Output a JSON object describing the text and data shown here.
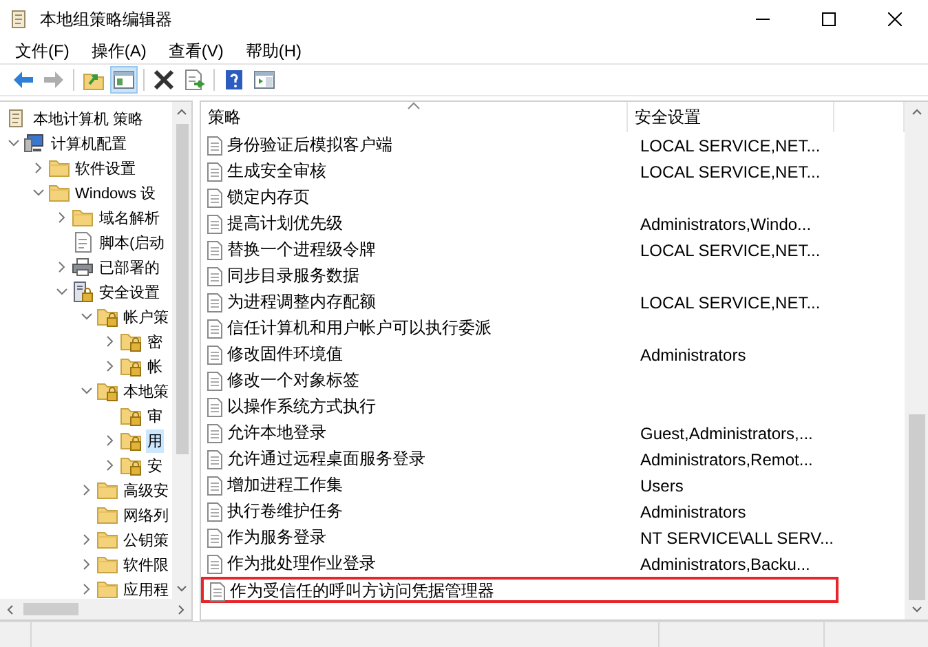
{
  "window": {
    "title": "本地组策略编辑器"
  },
  "menu": [
    "文件(F)",
    "操作(A)",
    "查看(V)",
    "帮助(H)"
  ],
  "toolbar": [
    [
      {
        "kind": "back",
        "disabled": false,
        "pressed": false
      },
      {
        "kind": "forward",
        "disabled": true,
        "pressed": false
      }
    ],
    [
      {
        "kind": "up",
        "disabled": false,
        "pressed": false
      },
      {
        "kind": "tree",
        "disabled": false,
        "pressed": true
      }
    ],
    [
      {
        "kind": "delete",
        "disabled": false,
        "pressed": false
      },
      {
        "kind": "export",
        "disabled": false,
        "pressed": false
      }
    ],
    [
      {
        "kind": "help",
        "disabled": false,
        "pressed": false
      },
      {
        "kind": "pane",
        "disabled": false,
        "pressed": false
      }
    ]
  ],
  "tree": {
    "kind": "policy",
    "label": "本地计算机 策略",
    "selected": false,
    "children": [
      {
        "kind": "computer",
        "label": "计算机配置",
        "expanded": true,
        "selected": false,
        "children": [
          {
            "kind": "folder",
            "label": "软件设置",
            "expanded": false,
            "selected": false
          },
          {
            "kind": "folder",
            "label": "Windows 设",
            "expanded": true,
            "selected": false,
            "children": [
              {
                "kind": "folder",
                "label": "域名解析",
                "expanded": false,
                "selected": false
              },
              {
                "kind": "script",
                "label": "脚本(启动",
                "selected": false
              },
              {
                "kind": "printer",
                "label": "已部署的",
                "expanded": false,
                "selected": false
              },
              {
                "kind": "security",
                "label": "安全设置",
                "expanded": true,
                "selected": false,
                "children": [
                  {
                    "kind": "lockfolder",
                    "label": "帐户策",
                    "expanded": true,
                    "selected": false,
                    "children": [
                      {
                        "kind": "lockfolder",
                        "label": "密",
                        "expanded": false,
                        "selected": false
                      },
                      {
                        "kind": "lockfolder",
                        "label": "帐",
                        "expanded": false,
                        "selected": false
                      }
                    ]
                  },
                  {
                    "kind": "lockfolder",
                    "label": "本地策",
                    "expanded": true,
                    "selected": false,
                    "children": [
                      {
                        "kind": "lockfolder",
                        "label": "审",
                        "selected": false
                      },
                      {
                        "kind": "lockfolder",
                        "label": "用",
                        "expanded": false,
                        "selected": true
                      },
                      {
                        "kind": "lockfolder",
                        "label": "安",
                        "expanded": false,
                        "selected": false
                      }
                    ]
                  },
                  {
                    "kind": "folder",
                    "label": "高级安",
                    "expanded": false,
                    "selected": false
                  },
                  {
                    "kind": "folder",
                    "label": "网络列",
                    "selected": false
                  },
                  {
                    "kind": "folder",
                    "label": "公钥策",
                    "expanded": false,
                    "selected": false
                  },
                  {
                    "kind": "folder",
                    "label": "软件限",
                    "expanded": false,
                    "selected": false
                  },
                  {
                    "kind": "folder",
                    "label": "应用程",
                    "expanded": false,
                    "selected": false
                  }
                ]
              }
            ]
          }
        ]
      }
    ]
  },
  "list": {
    "columns": [
      {
        "label": "策略",
        "sorted": true
      },
      {
        "label": "安全设置",
        "sorted": false
      }
    ],
    "rows": [
      {
        "name": "身份验证后模拟客户端",
        "setting": "LOCAL SERVICE,NET...",
        "outlined": false
      },
      {
        "name": "生成安全审核",
        "setting": "LOCAL SERVICE,NET...",
        "outlined": false
      },
      {
        "name": "锁定内存页",
        "outlined": false
      },
      {
        "name": "提高计划优先级",
        "setting": "Administrators,Windo...",
        "outlined": false
      },
      {
        "name": "替换一个进程级令牌",
        "setting": "LOCAL SERVICE,NET...",
        "outlined": false
      },
      {
        "name": "同步目录服务数据",
        "outlined": false
      },
      {
        "name": "为进程调整内存配额",
        "setting": "LOCAL SERVICE,NET...",
        "outlined": false
      },
      {
        "name": "信任计算机和用户帐户可以执行委派",
        "outlined": false
      },
      {
        "name": "修改固件环境值",
        "setting": "Administrators",
        "outlined": false
      },
      {
        "name": "修改一个对象标签",
        "outlined": false
      },
      {
        "name": "以操作系统方式执行",
        "outlined": false
      },
      {
        "name": "允许本地登录",
        "setting": "Guest,Administrators,...",
        "outlined": false
      },
      {
        "name": "允许通过远程桌面服务登录",
        "setting": "Administrators,Remot...",
        "outlined": false
      },
      {
        "name": "增加进程工作集",
        "setting": "Users",
        "outlined": false
      },
      {
        "name": "执行卷维护任务",
        "setting": "Administrators",
        "outlined": false
      },
      {
        "name": "作为服务登录",
        "setting": "NT SERVICE\\ALL SERV...",
        "outlined": false
      },
      {
        "name": "作为批处理作业登录",
        "setting": "Administrators,Backu...",
        "outlined": false
      },
      {
        "name": "作为受信任的呼叫方访问凭据管理器",
        "outlined": true
      }
    ]
  }
}
